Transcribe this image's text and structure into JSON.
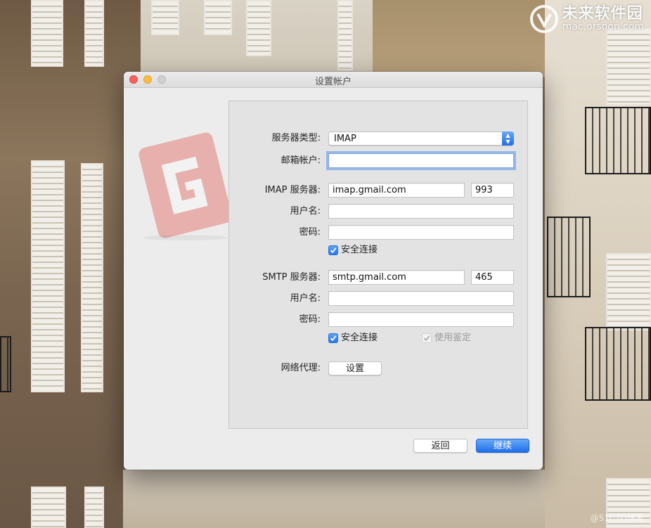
{
  "watermark": {
    "name": "未来软件园",
    "url": "mac.orsoon.com"
  },
  "corner_mark": "@51CTO博客",
  "window": {
    "title": "设置帐户"
  },
  "form": {
    "server_type": {
      "label": "服务器类型:",
      "value": "IMAP"
    },
    "email_account": {
      "label": "邮箱帐户:",
      "value": ""
    },
    "imap": {
      "server_label": "IMAP 服务器:",
      "server_value": "imap.gmail.com",
      "port_value": "993",
      "username_label": "用户名:",
      "username_value": "",
      "password_label": "密码:",
      "password_value": "",
      "secure_label": "安全连接",
      "secure_checked": true
    },
    "smtp": {
      "server_label": "SMTP 服务器:",
      "server_value": "smtp.gmail.com",
      "port_value": "465",
      "username_label": "用户名:",
      "username_value": "",
      "password_label": "密码:",
      "password_value": "",
      "secure_label": "安全连接",
      "secure_checked": true,
      "auth_label": "使用鉴定",
      "auth_checked": true,
      "auth_disabled": true
    },
    "proxy": {
      "label": "网络代理:",
      "button_label": "设置"
    }
  },
  "footer": {
    "back_label": "返回",
    "continue_label": "继续"
  },
  "colors": {
    "accent": "#2a79ec",
    "close": "#fc605c",
    "minimize": "#fdbc40",
    "logo": "#e0443a"
  }
}
